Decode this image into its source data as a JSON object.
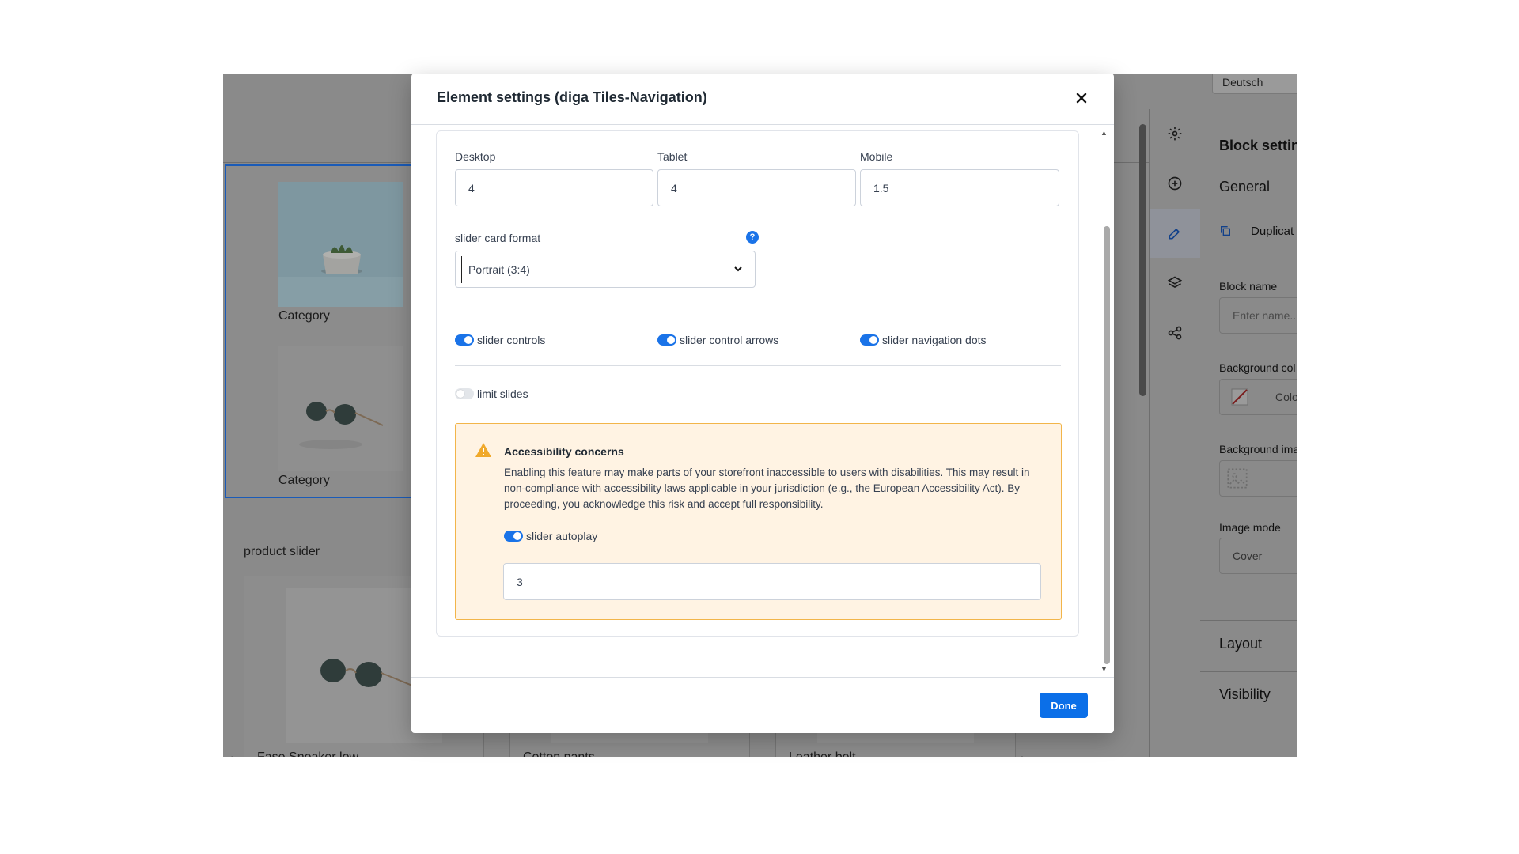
{
  "background": {
    "language": "Deutsch",
    "tiles": [
      {
        "label": "Category"
      },
      {
        "label": "Category"
      }
    ],
    "product_slider_label": "product slider",
    "products": [
      {
        "name": "Fase Sneaker low"
      },
      {
        "name": "Cotton pants"
      },
      {
        "name": "Leather belt"
      }
    ],
    "rail_icons": [
      "gear-icon",
      "plus-circle-icon",
      "edit-icon",
      "layers-icon",
      "share-icon"
    ],
    "block_panel": {
      "title": "Block settin",
      "general": "General",
      "duplicate": "Duplicat",
      "block_name_label": "Block name",
      "block_name_placeholder": "Enter name...",
      "background_color_label": "Background col",
      "background_color_value": "Colo",
      "background_image_label": "Background ima",
      "image_mode_label": "Image mode",
      "image_mode_value": "Cover",
      "layout": "Layout",
      "visibility": "Visibility"
    }
  },
  "modal": {
    "title": "Element settings (diga Tiles-Navigation)",
    "columns": [
      {
        "label": "Desktop",
        "value": "4"
      },
      {
        "label": "Tablet",
        "value": "4"
      },
      {
        "label": "Mobile",
        "value": "1.5"
      }
    ],
    "card_format": {
      "label": "slider card format",
      "help": "?",
      "value": "Portrait (3:4)"
    },
    "toggles": [
      {
        "label": "slider controls",
        "on": true
      },
      {
        "label": "slider control arrows",
        "on": true
      },
      {
        "label": "slider navigation dots",
        "on": true
      }
    ],
    "limit_slides": {
      "label": "limit slides",
      "on": false
    },
    "warning": {
      "title": "Accessibility concerns",
      "text": "Enabling this feature may make parts of your storefront inaccessible to users with disabilities. This may result in non-compliance with accessibility laws applicable in your jurisdiction (e.g., the European Accessibility Act). By proceeding, you acknowledge this risk and accept full responsibility.",
      "autoplay": {
        "label": "slider autoplay",
        "on": true
      },
      "autoplay_value": "3"
    },
    "done_label": "Done"
  },
  "colors": {
    "accent": "#0b6fe8",
    "warning_bg": "#fff3e3",
    "warning_border": "#f2b54a",
    "overlay": "#8a8a8a"
  }
}
